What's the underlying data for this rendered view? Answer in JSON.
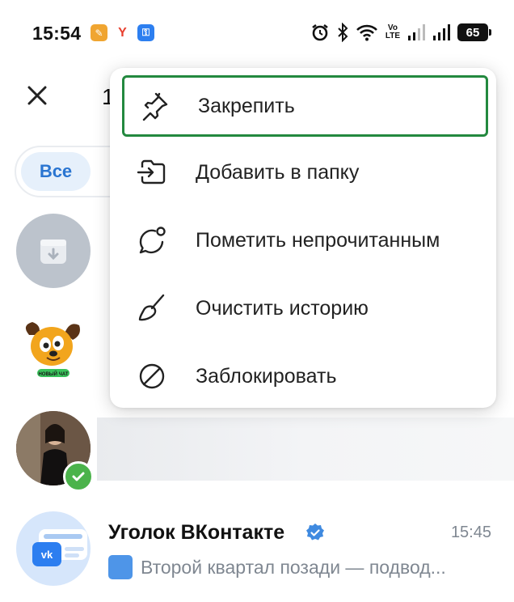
{
  "status_bar": {
    "time": "15:54",
    "network_label_top": "Vo",
    "network_label_bottom": "LTE",
    "battery": "65"
  },
  "header": {
    "close_icon": "close-icon",
    "count_fragment": "1"
  },
  "filters": {
    "active_chip": "Все"
  },
  "context_menu": {
    "items": [
      {
        "label": "Закрепить",
        "icon": "pin-icon",
        "focused": true
      },
      {
        "label": "Добавить в папку",
        "icon": "folder-add-icon",
        "focused": false
      },
      {
        "label": "Пометить непрочитанным",
        "icon": "mark-unread-icon",
        "focused": false
      },
      {
        "label": "Очистить историю",
        "icon": "broom-icon",
        "focused": false
      },
      {
        "label": "Заблокировать",
        "icon": "block-icon",
        "focused": false
      }
    ]
  },
  "chats": {
    "bot_caption": "НОВЫЙ ЧАТ",
    "vk_chat": {
      "title": "Уголок ВКонтакте",
      "time": "15:45",
      "preview": "Второй квартал позади — подвод..."
    }
  },
  "colors": {
    "accent": "#2a75d1",
    "focus_ring": "#23893f",
    "verified_green": "#4bb34b",
    "verified_blue": "#3f8ae0"
  }
}
